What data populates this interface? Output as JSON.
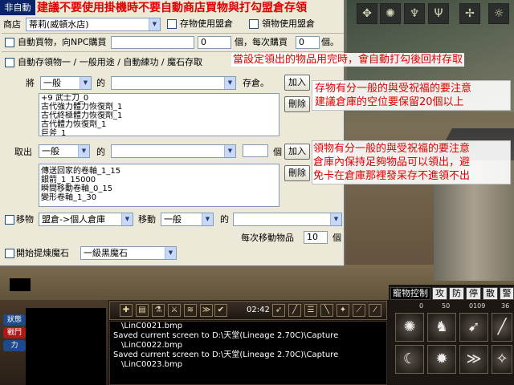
{
  "title_tab": "非自動",
  "banner": "建議不要使用掛機時不要自動商店買物與打勾盟倉存領",
  "store": {
    "label": "商店",
    "selected": "蒂莉(威頓水店)",
    "use_clan_store_label": "存物使用盟倉",
    "withdraw_clan_store_label": "領物使用盟倉"
  },
  "auto_buy": {
    "label": "自動買物，向NPC購買",
    "item_value": "",
    "count_value": "0",
    "count_unit": "個，每次購買",
    "per_buy_value": "0",
    "per_buy_unit": "個。"
  },
  "auto_store": {
    "label": "自動存領物一 / 一般用途 / 自動練功 / 魔石存取",
    "note": "當設定領出的物品用完時，會自動打勾後回村存取"
  },
  "deposit": {
    "label": "將",
    "type": "一般",
    "of_label": "的",
    "item": "",
    "suffix": "存倉。",
    "add_button": "加入",
    "delete_button": "刪除",
    "list": [
      "+9 武士刀_0",
      "古代強力體力恢復劑_1",
      "古代終極體力恢復劑_1",
      "古代體力恢復劑_1",
      "巨斧_1"
    ],
    "note_lines": [
      "存物有分一般的與受祝福的要注意",
      "建議倉庫的空位要保留20個以上"
    ]
  },
  "withdraw": {
    "label": "取出",
    "type": "一般",
    "of_label": "的",
    "item": "",
    "count_value": "",
    "count_unit": "個",
    "add_button": "加入",
    "delete_button": "刪除",
    "list": [
      "傳送回家的卷軸_1_15",
      "銀箭_1_15000",
      "瞬間移動卷軸_0_15",
      "變形卷軸_1_30"
    ],
    "note_lines": [
      "領物有分一般的與受祝福的要注意",
      "倉庫內保持足夠物品可以領出，避",
      "免卡在倉庫那裡發呆存不進領不出"
    ]
  },
  "move": {
    "label": "移物",
    "source": "盟倉->個人倉庫",
    "move_label": "移動",
    "type": "一般",
    "of_label": "的",
    "item": "",
    "per_move_label": "每次移動物品",
    "per_move_value": "10",
    "per_move_unit": "個"
  },
  "refine": {
    "label": "開始提煉魔石",
    "selected": "一級黑魔石"
  },
  "hud": {
    "time": "02:42",
    "side_buttons": [
      "狀態",
      "戰鬥",
      "力"
    ],
    "chat_lines": [
      "\\LinC0021.bmp",
      "Saved current screen to D:\\天堂(Lineage 2.70C)\\Capture",
      "\\LinC0022.bmp",
      "Saved current screen to D:\\天堂(Lineage 2.70C)\\Capture",
      "\\LinC0023.bmp"
    ],
    "pet_tabs": [
      "寵物控制",
      "攻",
      "防",
      "停",
      "散",
      "警"
    ],
    "pet_numbers": [
      "0",
      "50",
      "0109",
      "36"
    ]
  }
}
